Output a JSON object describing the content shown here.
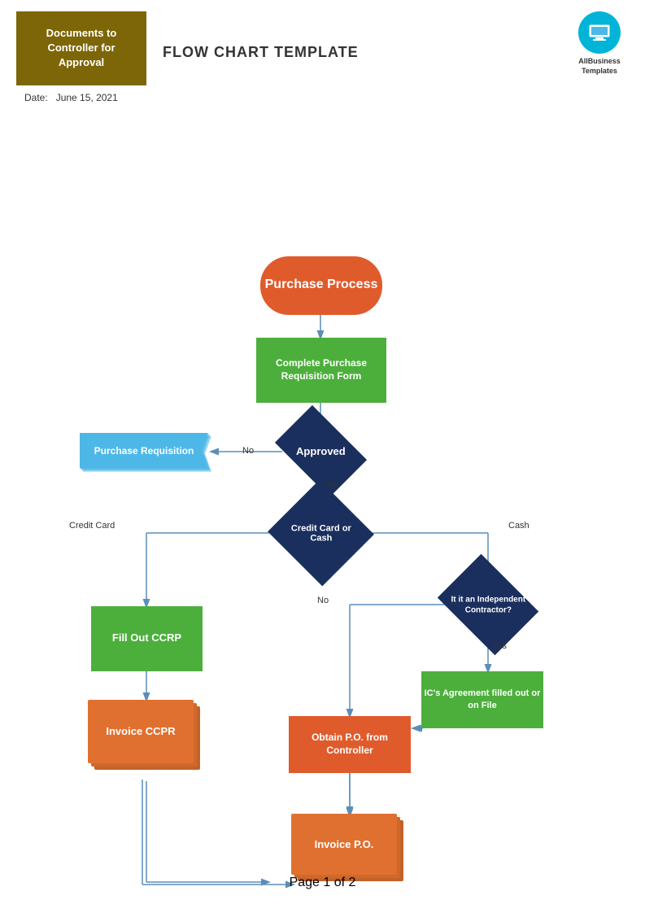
{
  "header": {
    "doc_box_label": "Documents to Controller for Approval",
    "title": "FLOW CHART TEMPLATE",
    "date_label": "Date:",
    "date_value": "June 15, 2021",
    "logo_text": "AllBusiness\nTemplates"
  },
  "flowchart": {
    "nodes": {
      "purchase_process": "Purchase Process",
      "complete_form": "Complete Purchase Requisition Form",
      "approved": "Approved",
      "purchase_requisition": "Purchase Requisition",
      "credit_card_or_cash": "Credit Card or Cash",
      "fill_out_ccrp": "Fill Out CCRP",
      "invoice_ccpr": "Invoice CCPR",
      "independent_contractor": "It it an Independent Contractor?",
      "ics_agreement": "IC's Agreement filled out or on File",
      "obtain_po": "Obtain P.O. from Controller",
      "invoice_po": "Invoice P.O."
    },
    "labels": {
      "no": "No",
      "yes": "Yes",
      "credit_card": "Credit Card",
      "cash": "Cash"
    },
    "page": "Page 1 of 2",
    "colors": {
      "orange": "#e05b2b",
      "green": "#4caf3c",
      "dark_navy": "#1a2f5e",
      "blue_banner": "#4db8e8"
    }
  }
}
